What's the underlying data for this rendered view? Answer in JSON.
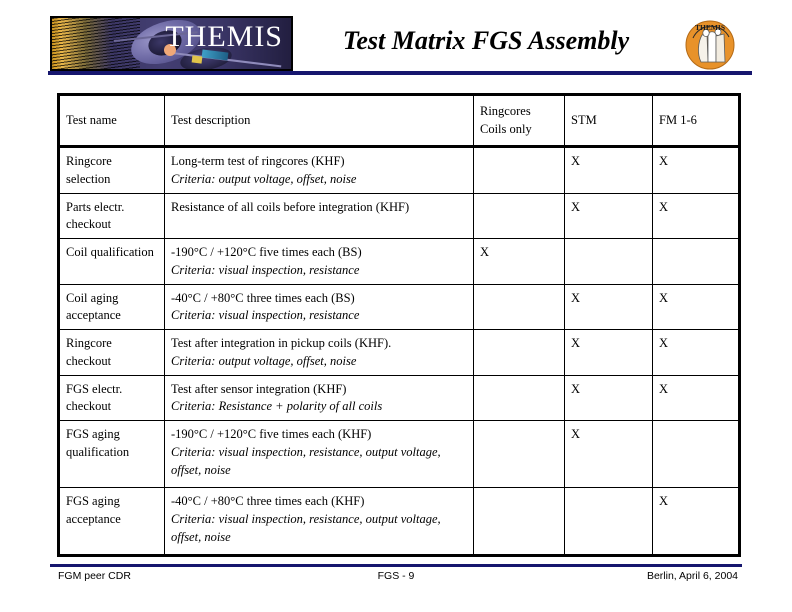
{
  "slide": {
    "title": "Test Matrix FGS Assembly",
    "logo_wordmark": "THEMIS",
    "accent_color": "#16166e",
    "patch_color": "#e8922a",
    "background_color": "#ffffff"
  },
  "table": {
    "headers": {
      "test_name": "Test name",
      "test_description": "Test description",
      "ringcores_line1": "Ringcores",
      "ringcores_line2": "Coils only",
      "stm": "STM",
      "fm": "FM 1-6"
    },
    "mark": "X",
    "rows": [
      {
        "name": "Ringcore selection",
        "description": "Long-term test of ringcores (KHF)",
        "criteria": "Criteria: output voltage, offset, noise",
        "ringcores": "",
        "stm": "X",
        "fm": "X",
        "tall": false
      },
      {
        "name": "Parts electr. checkout",
        "description": "Resistance of all coils before integration (KHF)",
        "criteria": "",
        "ringcores": "",
        "stm": "X",
        "fm": "X",
        "tall": false
      },
      {
        "name": "Coil qualification",
        "description": "-190°C / +120°C five times each (BS)",
        "criteria": "Criteria: visual inspection, resistance",
        "ringcores": "X",
        "stm": "",
        "fm": "",
        "tall": false
      },
      {
        "name": "Coil aging acceptance",
        "description": "-40°C / +80°C three times each (BS)",
        "criteria": "Criteria: visual inspection, resistance",
        "ringcores": "",
        "stm": "X",
        "fm": "X",
        "tall": false
      },
      {
        "name": "Ringcore checkout",
        "description": "Test after integration in pickup coils (KHF).",
        "criteria": "Criteria: output voltage, offset, noise",
        "ringcores": "",
        "stm": "X",
        "fm": "X",
        "tall": false
      },
      {
        "name": "FGS electr. checkout",
        "description": "Test after sensor integration (KHF)",
        "criteria": "Criteria: Resistance + polarity of all coils",
        "ringcores": "",
        "stm": "X",
        "fm": "X",
        "tall": false
      },
      {
        "name": "FGS aging qualification",
        "description": "-190°C / +120°C five times each (KHF)",
        "criteria": "Criteria: visual inspection, resistance, output voltage, offset, noise",
        "ringcores": "",
        "stm": "X",
        "fm": "",
        "tall": true
      },
      {
        "name": "FGS aging acceptance",
        "description": "-40°C / +80°C three times each (KHF)",
        "criteria": "Criteria: visual inspection, resistance, output voltage, offset, noise",
        "ringcores": "",
        "stm": "",
        "fm": "X",
        "tall": true
      }
    ]
  },
  "footer": {
    "left": "FGM peer CDR",
    "center": "FGS - 9",
    "right": "Berlin, April 6, 2004"
  }
}
